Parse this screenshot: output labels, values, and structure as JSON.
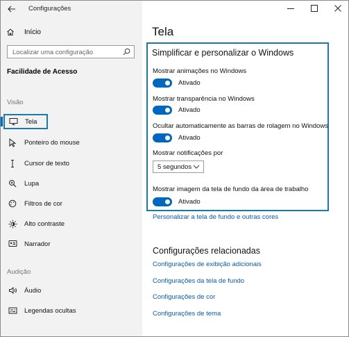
{
  "window": {
    "title": "Configurações",
    "controls": [
      "minimize-icon",
      "maximize-icon",
      "close-icon"
    ]
  },
  "sidebar": {
    "home_label": "Início",
    "search_placeholder": "Localizar uma configuração",
    "section_title": "Facilidade de Acesso",
    "groups": [
      {
        "label": "Visão",
        "items": [
          {
            "label": "Tela",
            "icon": "monitor-icon",
            "selected": true
          },
          {
            "label": "Ponteiro do mouse",
            "icon": "mouse-pointer-icon"
          },
          {
            "label": "Cursor de texto",
            "icon": "text-cursor-icon"
          },
          {
            "label": "Lupa",
            "icon": "magnifier-icon"
          },
          {
            "label": "Filtros de cor",
            "icon": "color-filter-icon"
          },
          {
            "label": "Alto contraste",
            "icon": "high-contrast-icon"
          },
          {
            "label": "Narrador",
            "icon": "narrator-icon"
          }
        ]
      },
      {
        "label": "Audição",
        "items": [
          {
            "label": "Áudio",
            "icon": "speaker-icon"
          },
          {
            "label": "Legendas ocultas",
            "icon": "captions-icon"
          }
        ]
      }
    ]
  },
  "main": {
    "page_title": "Tela",
    "section_title": "Simplificar e personalizar o Windows",
    "options": [
      {
        "label": "Mostrar animações no Windows",
        "state": "Ativado",
        "on": true
      },
      {
        "label": "Mostrar transparência no Windows",
        "state": "Ativado",
        "on": true
      },
      {
        "label": "Ocultar automaticamente as barras de rolagem no Windows",
        "state": "Ativado",
        "on": true
      }
    ],
    "notifications": {
      "label": "Mostrar notificações por",
      "value": "5 segundos"
    },
    "background_option": {
      "label": "Mostrar imagem da tela de fundo da área de trabalho",
      "state": "Ativado",
      "on": true
    },
    "personalize_link": "Personalizar a tela de fundo e outras cores",
    "related_title": "Configurações relacionadas",
    "related_links": [
      "Configurações de exibição adicionais",
      "Configurações da tela de fundo",
      "Configurações de cor",
      "Configurações de tema"
    ]
  },
  "colors": {
    "accent": "#0067c0",
    "highlight_border": "#1b78a8",
    "link": "#0a5aa8",
    "sidebar_bg": "#f2f2f2"
  }
}
